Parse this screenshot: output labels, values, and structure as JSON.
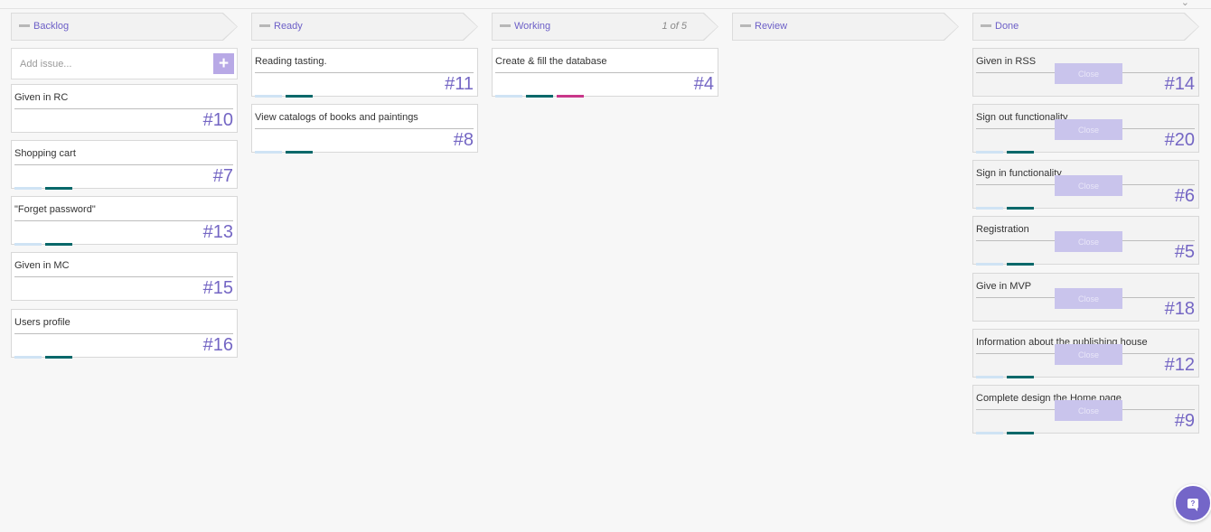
{
  "columns": [
    {
      "title": "Backlog",
      "wip": "",
      "add_placeholder": "Add issue...",
      "add_button": "+",
      "cards": [
        {
          "title": "Given in RC",
          "num": "#10"
        },
        {
          "title": "Shopping cart",
          "num": "#7"
        },
        {
          "title": "\"Forget password\"",
          "num": "#13"
        },
        {
          "title": "Given in MC",
          "num": "#15"
        },
        {
          "title": "Users profile",
          "num": "#16"
        }
      ]
    },
    {
      "title": "Ready",
      "wip": "",
      "cards": [
        {
          "title": "Reading tasting.",
          "num": "#11"
        },
        {
          "title": "View catalogs of books and paintings",
          "num": "#8"
        }
      ]
    },
    {
      "title": "Working",
      "wip": "1 of 5",
      "cards": [
        {
          "title": "Create & fill the database",
          "num": "#4"
        }
      ]
    },
    {
      "title": "Review",
      "wip": "",
      "cards": []
    },
    {
      "title": "Done",
      "wip": "",
      "close_label": "Close",
      "cards": [
        {
          "title": "Given in RSS",
          "num": "#14"
        },
        {
          "title": "Sign out functionality",
          "num": "#20"
        },
        {
          "title": "Sign in functionality",
          "num": "#6"
        },
        {
          "title": "Registration",
          "num": "#5"
        },
        {
          "title": "Give in MVP",
          "num": "#18"
        },
        {
          "title": "Information about the publishing house",
          "num": "#12"
        },
        {
          "title": "Complete design the Home page",
          "num": "#9"
        }
      ]
    }
  ],
  "help": {
    "icon": "?"
  },
  "colors": {
    "accent": "#7466c4",
    "tag_light_blue": "#cfe3f4",
    "tag_teal": "#07686a",
    "tag_magenta": "#c9378a",
    "close_button": "#c9c4ec"
  }
}
